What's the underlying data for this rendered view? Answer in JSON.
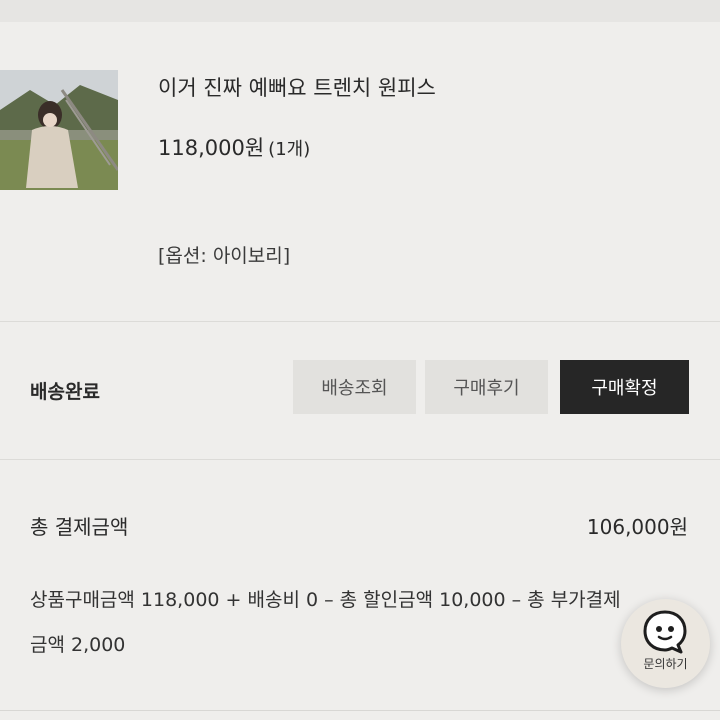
{
  "product": {
    "title": "이거 진짜 예뻐요 트렌치 원피스",
    "price": "118,000원",
    "quantity": "(1개)",
    "option": "[옵션: 아이보리]"
  },
  "delivery": {
    "status": "배송완료",
    "buttons": {
      "track": "배송조회",
      "review": "구매후기",
      "confirm": "구매확정"
    }
  },
  "payment": {
    "label": "총 결제금액",
    "total": "106,000원",
    "breakdown": "상품구매금액 118,000 + 배송비 0 – 총 할인금액 10,000 – 총 부가결제금액 2,000"
  },
  "chat": {
    "label": "문의하기",
    "icon": "chat-bubble-icon"
  }
}
